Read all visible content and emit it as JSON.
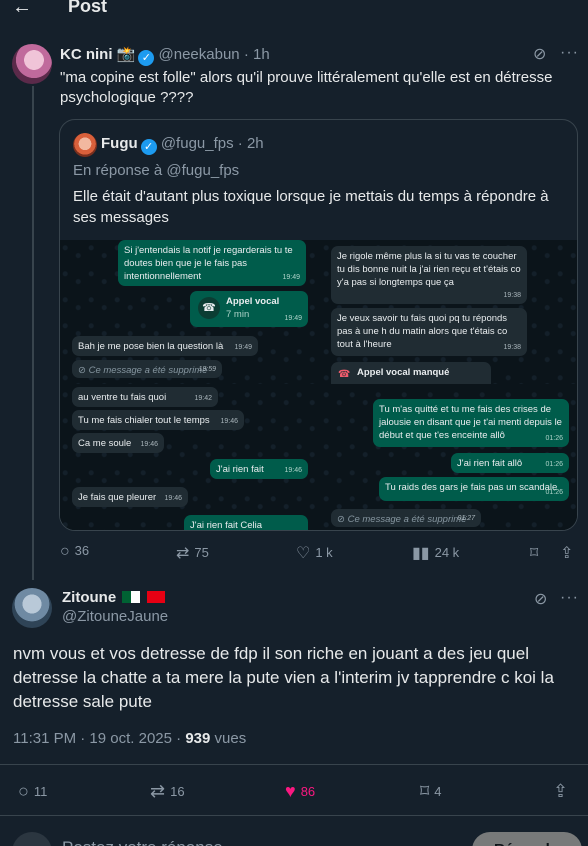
{
  "header": {
    "back_icon": "arrow-left-icon",
    "title": "Post"
  },
  "post1": {
    "author": {
      "name": "KC nini 📸",
      "handle": "@neekabun",
      "time": "1h"
    },
    "text": "\"ma copine est folle\" alors qu'il prouve littéralement qu'elle est en détresse psychologique ????",
    "quote": {
      "author": {
        "name": "Fugu",
        "handle": "@fugu_fps",
        "time": "2h"
      },
      "reply_to": "En réponse à @fugu_fps",
      "text": "Elle était d'autant plus toxique lorsque je mettais du temps à répondre à ses messages",
      "chat": {
        "p1": [
          {
            "text": "Si j'entendais la notif je regarderais tu te doutes bien que je le fais pas intentionnellement",
            "time": "19:49"
          },
          {
            "text": "Appel vocal",
            "sub": "7 min",
            "time": "19:49"
          },
          {
            "text": "Bah je me pose bien la question là",
            "time": "19:49"
          },
          {
            "text": "Ce message a été supprimé",
            "time": "19:59"
          }
        ],
        "p2": [
          {
            "text": "Je rigole même plus la si tu vas te coucher tu dis bonne nuit la j'ai rien reçu et t'étais co y'a pas si longtemps que ça",
            "time": "19:38"
          },
          {
            "text": "Je veux savoir tu fais quoi pq tu réponds pas à une h du matin alors que t'étais co tout à l'heure",
            "time": "19:38"
          },
          {
            "text": "Appel vocal manqué",
            "time": ""
          }
        ],
        "p3": [
          {
            "text": "au ventre tu fais quoi",
            "time": "19:42"
          },
          {
            "text": "Tu me fais chialer tout le temps",
            "time": "19:46"
          },
          {
            "text": "Ca me soule",
            "time": "19:46"
          },
          {
            "text": "J'ai rien fait",
            "time": "19:46"
          },
          {
            "text": "Je fais que pleurer",
            "time": "19:46"
          },
          {
            "text": "J'ai rien fait Celia",
            "time": ""
          }
        ],
        "p4": [
          {
            "text": "Tu m'as quitté et tu me fais des crises de jalousie en disant que je t'ai menti depuis le début et que t'es enceinte allô",
            "time": "01:26"
          },
          {
            "text": "J'ai rien fait allô",
            "time": "01:26"
          },
          {
            "text": "Tu raids des gars je fais pas un scandale",
            "time": "01:26"
          },
          {
            "text": "Ce message a été supprimé",
            "time": "01:27"
          }
        ]
      }
    },
    "stats": {
      "replies": "36",
      "reposts": "75",
      "likes": "1 k",
      "views": "24 k"
    }
  },
  "post2": {
    "author": {
      "name": "Zitoune",
      "handle": "@ZitouneJaune"
    },
    "text": "nvm vous et vos detresse de fdp il son riche en jouant a des jeu quel detresse la chatte a ta mere la pute vien a l'interim jv tapprendre c koi la detresse sale pute",
    "time": "11:31 PM · 19 oct. 2025 · ",
    "views_count": "939",
    "views_label": " vues",
    "stats": {
      "replies": "11",
      "reposts": "16",
      "likes": "86",
      "bookmarks": "4"
    }
  },
  "reply": {
    "placeholder": "Postez votre réponse",
    "button": "Répondre"
  },
  "colors": {
    "accent": "#1d9bf0",
    "like": "#f91880",
    "bg": "#15202b"
  }
}
